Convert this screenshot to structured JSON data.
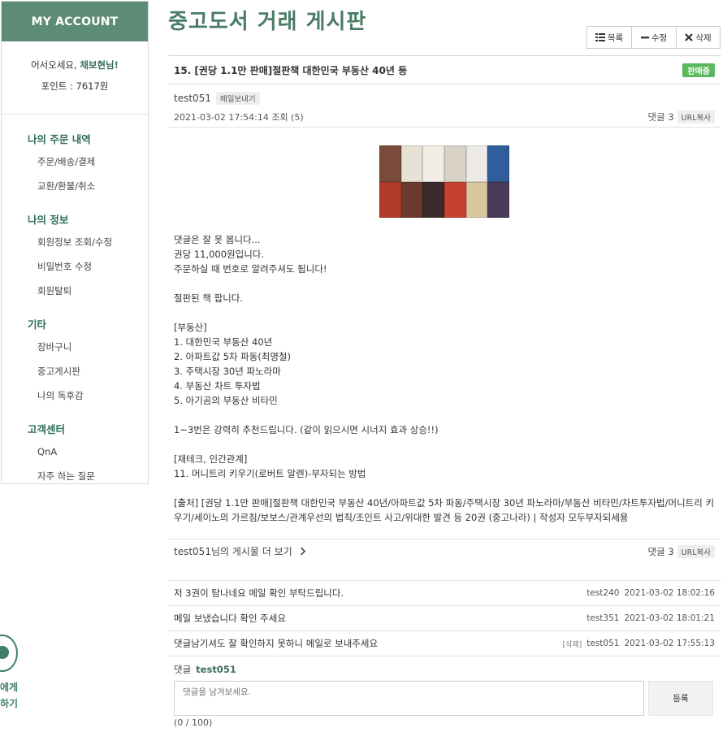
{
  "sidebar": {
    "header": "MY ACCOUNT",
    "welcome_prefix": "어서오세요, ",
    "username": "채보현님!",
    "points": "포인트 : 7617원",
    "sections": [
      {
        "title": "나의 주문 내역",
        "items": [
          "주문/배송/결제",
          "교환/환불/취소"
        ]
      },
      {
        "title": "나의 정보",
        "items": [
          "회원정보 조회/수정",
          "비밀번호 수정",
          "회원탈퇴"
        ]
      },
      {
        "title": "기타",
        "items": [
          "장바구니",
          "중고게시판",
          "나의 독후감"
        ]
      },
      {
        "title": "고객센터",
        "items": [
          "QnA",
          "자주 하는 질문"
        ]
      }
    ]
  },
  "chat": {
    "line1": "에게",
    "line2": "하기"
  },
  "page_title": "중고도서 거래 게시판",
  "toolbar": {
    "list": "목록",
    "edit": "수정",
    "delete": "삭제"
  },
  "post": {
    "title": "15. [권당 1.1만 판매]절판책 대한민국 부동산 40년 등",
    "status": "판매중",
    "author": "test051",
    "mail_tag": "메일보내기",
    "datetime": "2021-03-02 17:54:14 조회 (5)",
    "comment_count": "댓글 3",
    "url_copy": "URL복사",
    "body": "댓글은 잘 못 봅니다...\n권당 11,000원입니다.\n주문하실 때 번호로 알려주셔도 됩니다!\n\n절판된 책 팝니다.\n\n[부동산]\n1. 대한민국 부동산 40년\n2. 아파트값 5차 파동(최명철)\n3. 주택시장 30년 파노라마\n4. 부동산 차트 투자법\n5. 아기곰의 부동산 비타민\n\n1~3번은 강력히 추천드립니다. (같이 읽으시면 시너지 효과 상승!!)\n\n[재테크, 인간관계]\n11. 머니트리 키우기(로버트 알렌)-부자되는 방법\n\n[출처] [권당 1.1만 판매]절판책 대한민국 부동산 40년/아파트값 5차 파동/주택시장 30년 파노라마/부동산 비타민/차트투자법/머니트리 키우기/세이노의 가르침/보보스/관계우선의 법칙/조인트 사고/위대한 발견 등 20권 (중고나라) | 작성자 모두부자되세용",
    "more_posts": "test051님의 게시물 더 보기",
    "more_comment_count": "댓글 3",
    "more_url_copy": "URL복사"
  },
  "comments": [
    {
      "text": "저 3권이 탐나네요 메일 확인 부탁드립니다.",
      "delete": "",
      "author": "test240",
      "date": "2021-03-02 18:02:16"
    },
    {
      "text": "메일 보냈습니다 확인 주세요",
      "delete": "",
      "author": "test351",
      "date": "2021-03-02 18:01:21"
    },
    {
      "text": "댓글남기셔도 잘 확인하지 못하니 메일로 보내주세요",
      "delete": "[삭제]",
      "author": "test051",
      "date": "2021-03-02 17:55:13"
    }
  ],
  "reply": {
    "label": "댓글",
    "user": "test051",
    "placeholder": "댓글을 남겨보세요.",
    "submit": "등록",
    "counter": "(0 / 100)"
  },
  "thumbnail_colors": [
    "#7a4a3a",
    "#e8e2d6",
    "#f1ece4",
    "#d8d2c6",
    "#ecebe7",
    "#2f5e9a",
    "#b23a2a",
    "#6b3b2f",
    "#3a2b2a",
    "#c8402f",
    "#d8c7a0",
    "#4a3a5a"
  ]
}
